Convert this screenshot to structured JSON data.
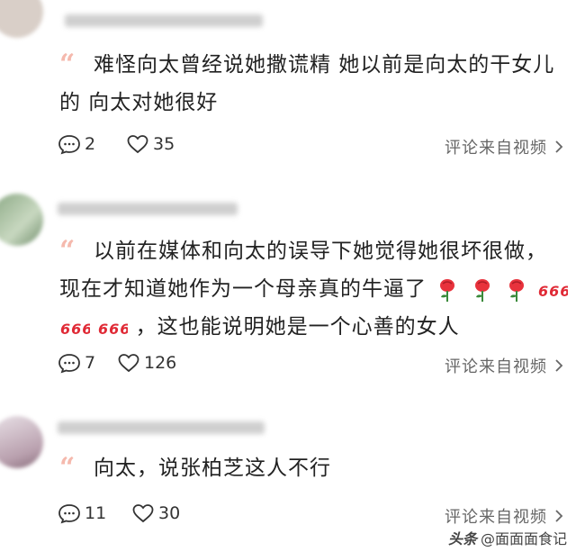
{
  "comments": [
    {
      "text": "难怪向太曾经说她撒谎精  她以前是向太的干女儿的 向太对她很好",
      "reply_count": "2",
      "like_count": "35",
      "source_label": "评论来自视频"
    },
    {
      "text_line1": "以前在媒体和向太的误导下她觉得她很坏很做，",
      "text_line2": "现在才知道她作为一个母亲真的牛逼了",
      "text_line3": "，这也能说明她是一个心善的女人",
      "reply_count": "7",
      "like_count": "126",
      "source_label": "评论来自视频",
      "emojis": [
        "rose-emoji",
        "rose-emoji",
        "rose-emoji",
        "666-emoji",
        "666-emoji",
        "666-emoji"
      ]
    },
    {
      "text": "向太，说张柏芝这人不行",
      "reply_count": "11",
      "like_count": "30",
      "source_label": "评论来自视频"
    }
  ],
  "watermark": {
    "prefix": "头条",
    "handle": "@面面面食记"
  },
  "colors": {
    "quote": "#f5b9ad",
    "rose": "#e8323c",
    "six": "#e02a36"
  }
}
